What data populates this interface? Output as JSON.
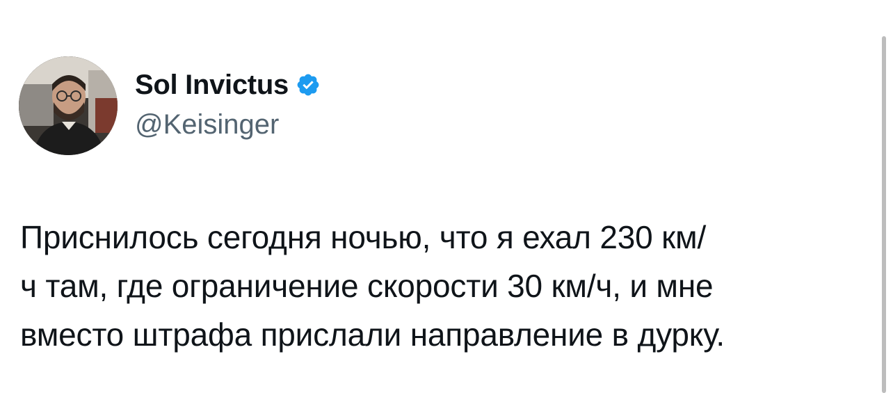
{
  "author": {
    "display_name": "Sol Invictus",
    "handle": "@Keisinger",
    "verified": true,
    "verified_icon": "verified-badge-icon",
    "verified_color": "#1d9bf0"
  },
  "tweet": {
    "lines": [
      "Приснилось сегодня ночью, что я ехал 230 км/",
      "ч там, где ограничение скорости 30 км/ч, и мне",
      "вместо штрафа прислали направление в дурку."
    ]
  },
  "colors": {
    "text_primary": "#0f1419",
    "text_secondary": "#536471",
    "background": "#ffffff"
  }
}
